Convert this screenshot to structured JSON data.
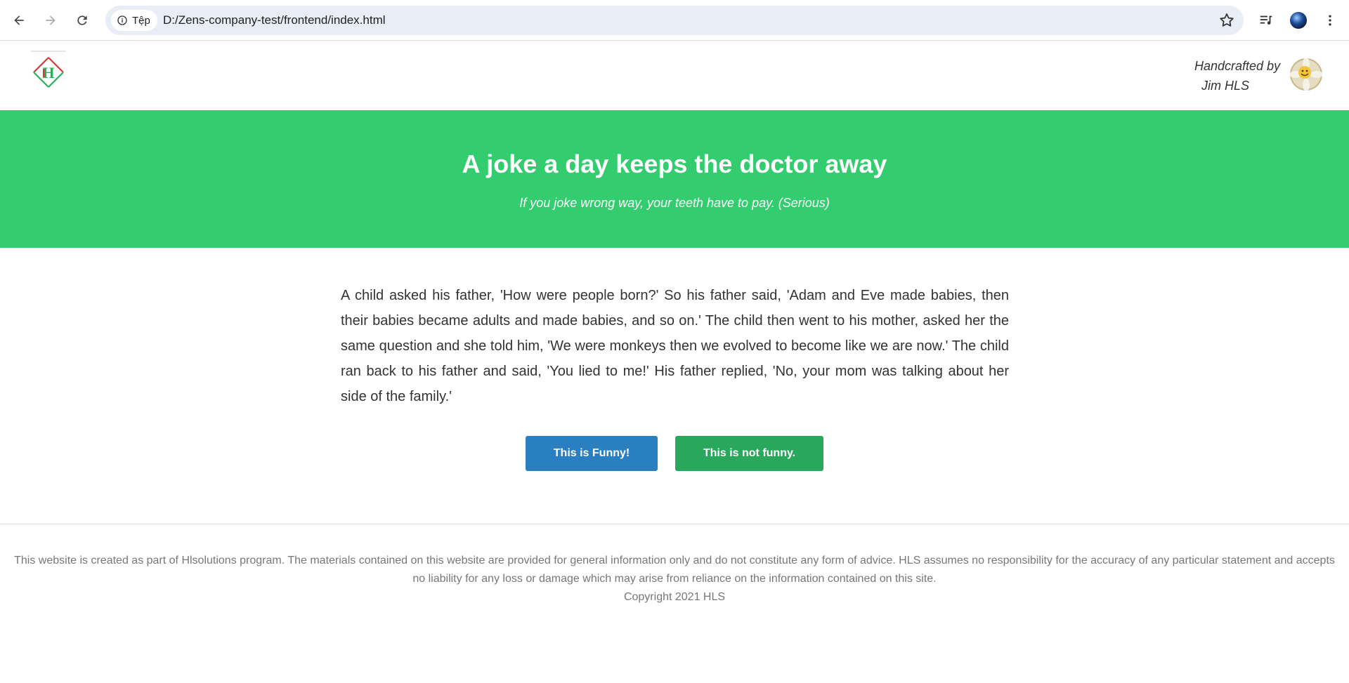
{
  "browser": {
    "site_info_label": "Tệp",
    "url": "D:/Zens-company-test/frontend/index.html"
  },
  "header": {
    "logo_letter": "H",
    "author_line1": "Handcrafted by",
    "author_line2": "Jim HLS"
  },
  "hero": {
    "title": "A joke a day keeps the doctor away",
    "subtitle": "If you joke wrong way, your teeth have to pay. (Serious)"
  },
  "joke": {
    "text": "A child asked his father, 'How were people born?' So his father said, 'Adam and Eve made babies, then their babies became adults and made babies, and so on.' The child then went to his mother, asked her the same question and she told him, 'We were monkeys then we evolved to become like we are now.' The child ran back to his father and said, 'You lied to me!' His father replied, 'No, your mom was talking about her side of the family.'"
  },
  "buttons": {
    "funny": "This is Funny!",
    "not_funny": "This is not funny."
  },
  "footer": {
    "disclaimer": "This website is created as part of Hlsolutions program. The materials contained on this website are provided for general information only and do not constitute any form of advice. HLS assumes no responsibility for the accuracy of any particular statement and accepts no liability for any loss or damage which may arise from reliance on the information contained on this site.",
    "copyright": "Copyright 2021 HLS"
  },
  "colors": {
    "hero_bg": "#33cc6f",
    "funny_button": "#2a7fc1",
    "not_funny_button": "#29a85b"
  },
  "icons": [
    "back-icon",
    "forward-icon",
    "reload-icon",
    "info-icon",
    "star-icon",
    "media-control-icon",
    "profile-icon",
    "more-menu-icon"
  ]
}
